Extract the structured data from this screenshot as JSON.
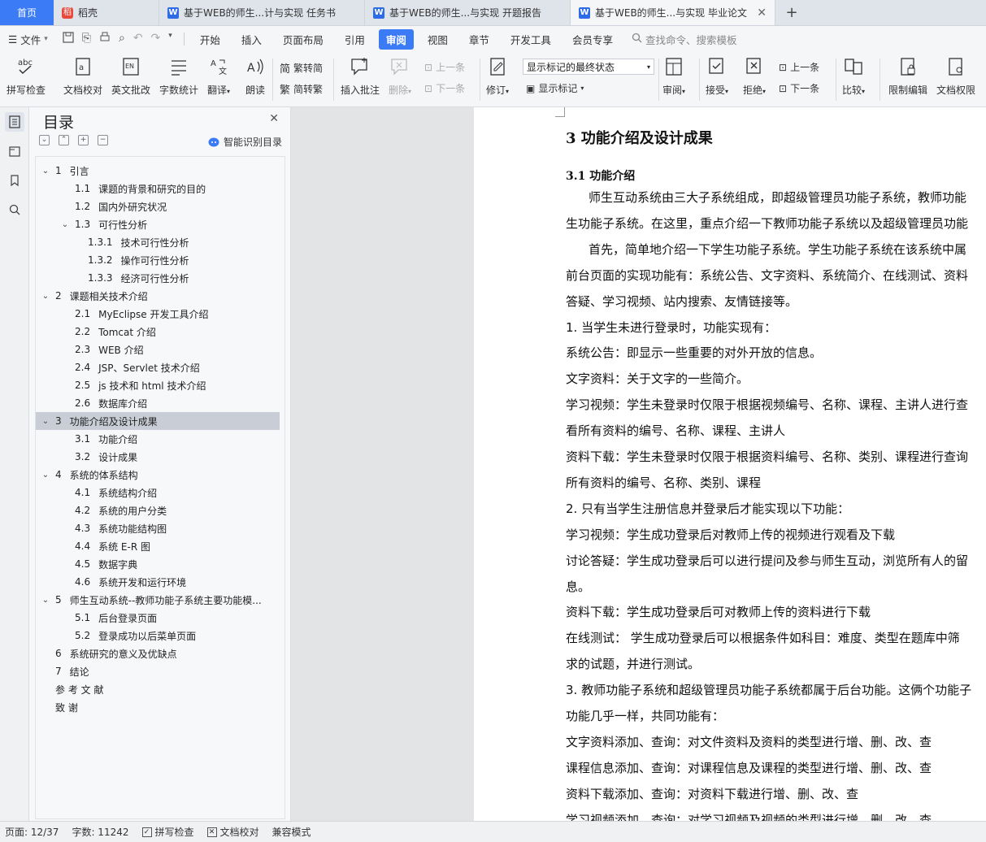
{
  "tabs": [
    {
      "label": "首页",
      "icon": "home"
    },
    {
      "label": "稻壳",
      "icon": "daoke-icon"
    },
    {
      "label": "基于WEB的师生...计与实现 任务书",
      "icon": "wps-writer-icon"
    },
    {
      "label": "基于WEB的师生...与实现 开题报告",
      "icon": "wps-writer-icon"
    },
    {
      "label": "基于WEB的师生...与实现 毕业论文",
      "icon": "wps-writer-icon",
      "active": true
    }
  ],
  "menu": {
    "file_label": "文件",
    "items": [
      "开始",
      "插入",
      "页面布局",
      "引用",
      "审阅",
      "视图",
      "章节",
      "开发工具",
      "会员专享"
    ],
    "active": "审阅",
    "search_placeholder": "查找命令、搜索模板"
  },
  "ribbon": {
    "spell_check": "拼写检查",
    "doc_proof": "文档校对",
    "eng_correct": "英文批改",
    "word_count": "字数统计",
    "translate": "翻译",
    "read_aloud": "朗读",
    "trad_to_simp": "繁转简",
    "simp_to_trad": "简转繁",
    "insert_comment": "插入批注",
    "delete": "删除",
    "prev_comment": "上一条",
    "next_comment": "下一条",
    "track_changes": "修订",
    "display_mode": "显示标记的最终状态",
    "show_markup": "显示标记",
    "review": "审阅",
    "accept": "接受",
    "reject": "拒绝",
    "prev": "上一条",
    "next": "下一条",
    "compare": "比较",
    "restrict_edit": "限制编辑",
    "doc_permission": "文档权限"
  },
  "toc": {
    "title": "目录",
    "smart_label": "智能识别目录",
    "items": [
      {
        "num": "1",
        "text": "引言",
        "level": 1,
        "expanded": true
      },
      {
        "num": "1.1",
        "text": "课题的背景和研究的目的",
        "level": 2
      },
      {
        "num": "1.2",
        "text": "国内外研究状况",
        "level": 2
      },
      {
        "num": "1.3",
        "text": "可行性分析",
        "level": 2,
        "expanded": true
      },
      {
        "num": "1.3.1",
        "text": "技术可行性分析",
        "level": 3
      },
      {
        "num": "1.3.2",
        "text": "操作可行性分析",
        "level": 3
      },
      {
        "num": "1.3.3",
        "text": "经济可行性分析",
        "level": 3
      },
      {
        "num": "2",
        "text": "课题相关技术介绍",
        "level": 1,
        "expanded": true
      },
      {
        "num": "2.1",
        "text": "MyEclipse 开发工具介绍",
        "level": 2
      },
      {
        "num": "2.2",
        "text": "Tomcat 介绍",
        "level": 2
      },
      {
        "num": "2.3",
        "text": "WEB 介绍",
        "level": 2
      },
      {
        "num": "2.4",
        "text": "JSP、Servlet 技术介绍",
        "level": 2
      },
      {
        "num": "2.5",
        "text": "js 技术和 html 技术介绍",
        "level": 2
      },
      {
        "num": "2.6",
        "text": "数据库介绍",
        "level": 2
      },
      {
        "num": "3",
        "text": "功能介绍及设计成果",
        "level": 1,
        "expanded": true,
        "selected": true
      },
      {
        "num": "3.1",
        "text": "功能介绍",
        "level": 2
      },
      {
        "num": "3.2",
        "text": "设计成果",
        "level": 2
      },
      {
        "num": "4",
        "text": "系统的体系结构",
        "level": 1,
        "expanded": true
      },
      {
        "num": "4.1",
        "text": "系统结构介绍",
        "level": 2
      },
      {
        "num": "4.2",
        "text": "系统的用户分类",
        "level": 2
      },
      {
        "num": "4.3",
        "text": "系统功能结构图",
        "level": 2
      },
      {
        "num": "4.4",
        "text": "系统 E-R 图",
        "level": 2
      },
      {
        "num": "4.5",
        "text": "数据字典",
        "level": 2
      },
      {
        "num": "4.6",
        "text": "系统开发和运行环境",
        "level": 2
      },
      {
        "num": "5",
        "text": "师生互动系统--教师功能子系统主要功能模...",
        "level": 1,
        "expanded": true
      },
      {
        "num": "5.1",
        "text": "后台登录页面",
        "level": 2
      },
      {
        "num": "5.2",
        "text": "登录成功以后菜单页面",
        "level": 2
      },
      {
        "num": "6",
        "text": "系统研究的意义及优缺点",
        "level": 1
      },
      {
        "num": "7",
        "text": "结论",
        "level": 1
      },
      {
        "num": "",
        "text": "参 考 文 献",
        "level": 1
      },
      {
        "num": "",
        "text": "致  谢",
        "level": 1
      }
    ]
  },
  "document": {
    "heading1": "3   功能介绍及设计成果",
    "heading2": "3.1   功能介绍",
    "lines": [
      {
        "text": "师生互动系统由三大子系统组成，即超级管理员功能子系统，教师功能",
        "indent": true
      },
      {
        "text": "生功能子系统。在这里，重点介绍一下教师功能子系统以及超级管理员功能",
        "indent": false
      },
      {
        "text": "首先，简单地介绍一下学生功能子系统。学生功能子系统在该系统中属",
        "indent": true
      },
      {
        "text": "前台页面的实现功能有：系统公告、文字资料、系统简介、在线测试、资料",
        "indent": false
      },
      {
        "text": "答疑、学习视频、站内搜索、友情链接等。",
        "indent": false
      },
      {
        "text": "1. 当学生未进行登录时，功能实现有：",
        "indent": false
      },
      {
        "text": "系统公告：即显示一些重要的对外开放的信息。",
        "indent": false
      },
      {
        "text": "文字资料：关于文字的一些简介。",
        "indent": false
      },
      {
        "text": "学习视频：学生未登录时仅限于根据视频编号、名称、课程、主讲人进行查",
        "indent": false
      },
      {
        "text": "看所有资料的编号、名称、课程、主讲人",
        "indent": false
      },
      {
        "text": "资料下载：学生未登录时仅限于根据资料编号、名称、类别、课程进行查询",
        "indent": false
      },
      {
        "text": "所有资料的编号、名称、类别、课程",
        "indent": false
      },
      {
        "text": "2. 只有当学生注册信息并登录后才能实现以下功能：",
        "indent": false
      },
      {
        "text": "学习视频：学生成功登录后对教师上传的视频进行观看及下载",
        "indent": false
      },
      {
        "text": "讨论答疑：学生成功登录后可以进行提问及参与师生互动，浏览所有人的留",
        "indent": false
      },
      {
        "text": "息。",
        "indent": false
      },
      {
        "text": "资料下载：学生成功登录后可对教师上传的资料进行下载",
        "indent": false
      },
      {
        "text": "在线测试：  学生成功登录后可以根据条件如科目：难度、类型在题库中筛",
        "indent": false
      },
      {
        "text": "求的试题，并进行测试。",
        "indent": false
      },
      {
        "text": "3. 教师功能子系统和超级管理员功能子系统都属于后台功能。这俩个功能子",
        "indent": false
      },
      {
        "text": "功能几乎一样，共同功能有：",
        "indent": false
      },
      {
        "text": "文字资料添加、查询：对文件资料及资料的类型进行增、删、改、查",
        "indent": false
      },
      {
        "text": "课程信息添加、查询：对课程信息及课程的类型进行增、删、改、查",
        "indent": false
      },
      {
        "text": "资料下载添加、查询：对资料下载进行增、删、改、查",
        "indent": false
      },
      {
        "text": "学习视频添加、查询：对学习视频及视频的类型进行增、删、改、查",
        "indent": false
      }
    ]
  },
  "status": {
    "page": "页面: 12/37",
    "words": "字数: 11242",
    "spell_check": "拼写检查",
    "doc_proof": "文档校对",
    "compat_mode": "兼容模式"
  }
}
